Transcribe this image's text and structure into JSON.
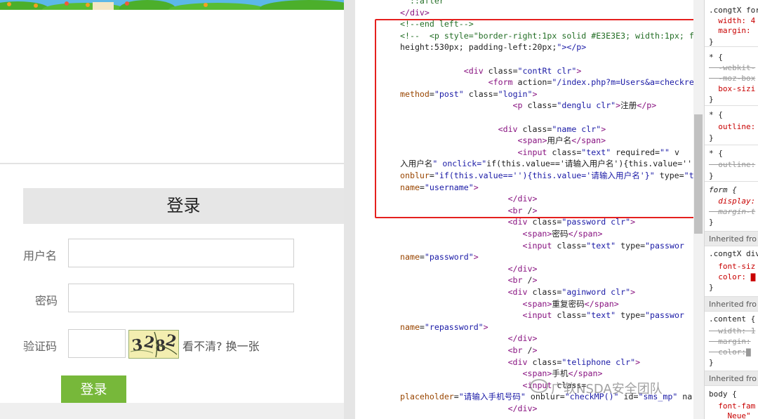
{
  "login_form": {
    "title": "登录",
    "username_label": "用户名",
    "password_label": "密码",
    "captcha_label": "验证码",
    "captcha_chars": [
      "3",
      "2",
      "8",
      "2"
    ],
    "refresh_text": "看不清? 换一张",
    "submit_label": "登录"
  },
  "source_lines": [
    "  ::after",
    "</div>",
    "<!--end left-->",
    "<!--  <p style=\"border-right:1px solid #E3E3E3; width:1px; flo",
    "height:530px; padding-left:20px;\"></p>",
    "",
    "             <div class=\"contRt clr\">",
    "                  <form action=\"/index.php?m=Users&a=checkre",
    "method=\"post\" class=\"login\">",
    "                       <p class=\"denglu clr\">注册</p>",
    "",
    "                    <div class=\"name clr\">",
    "                        <span>用户名</span>",
    "                        <input class=\"text\" required=\"\" v",
    "入用户名\" onclick=\"if(this.value=='请输入用户名'){this.value=''",
    "onblur=\"if(this.value==''){this.value='请输入用户名'}\" type=\"te",
    "name=\"username\">",
    "                      </div>",
    "                      <br />",
    "                      <div class=\"password clr\">",
    "                         <span>密码</span>",
    "                         <input class=\"text\" type=\"passwor",
    "name=\"password\">",
    "                      </div>",
    "                      <br />",
    "                      <div class=\"aginword clr\">",
    "                         <span>重复密码</span>",
    "                         <input class=\"text\" type=\"passwor",
    "name=\"repassword\">",
    "                      </div>",
    "                      <br />",
    "                      <div class=\"teliphone clr\">",
    "                         <span>手机</span>",
    "                         <input class=",
    "placeholder=\"请输入手机号码\" onblur=\"checkMP()\" id=\"sms_mp\" nar",
    "                      </div>"
  ],
  "styles_panel": {
    "lines": [
      ".congtX for",
      "  width: 4",
      "  margin:",
      "}",
      "* {",
      "  -webkit-",
      "  -moz-box",
      "  box-sizi",
      "}",
      "* {",
      "  outline:",
      "}",
      "* {",
      "  outline:",
      "}",
      "form {",
      "  display:",
      "  margin-t",
      "}",
      ".congtX div",
      "  font-siz",
      "  color: ▇",
      "}",
      ".content {",
      "  width: 1",
      "  margin:",
      "  color:▇",
      "}",
      "body {",
      "  font-fam",
      "    Neue\""
    ],
    "inherited_label_1": "Inherited fro",
    "inherited_label_2": "Inherited fro",
    "inherited_label_3": "Inherited fro"
  },
  "watermark": "广软NSDA安全团队",
  "colors": {
    "login_button": "#77b83a",
    "highlight_box": "#e5201e",
    "tag": "#881280",
    "attribute": "#994500",
    "value": "#1a1aa6"
  }
}
